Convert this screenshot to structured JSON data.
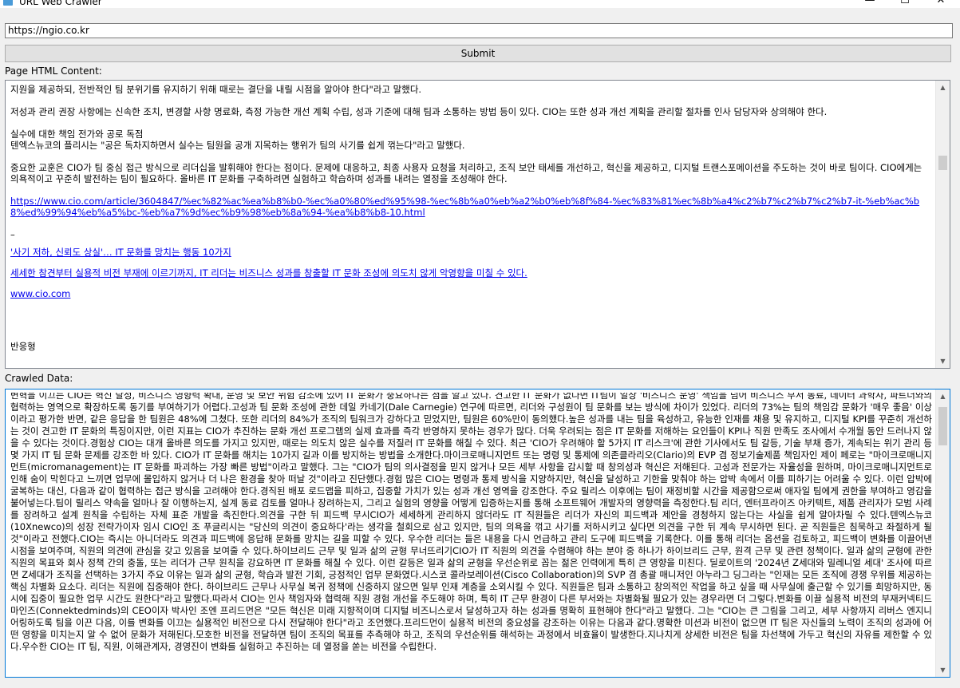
{
  "window": {
    "title": "URL Web Crawler",
    "minimize": "—",
    "maximize": "☐",
    "close": "✕"
  },
  "url_input": {
    "value": "https://ngio.co.kr"
  },
  "submit": {
    "label": "Submit"
  },
  "html_panel": {
    "label": "Page HTML Content:",
    "lines": [
      "지원을 제공하되, 전반적인 팀 분위기를 유지하기 위해 때로는 결단을 내릴 시점을 알아야 한다\"라고 말했다.",
      "",
      "저성과 관리 권장 사항에는 신속한 조치, 변경할 사항 명료화, 측정 가능한 개선 계획 수립, 성과 기준에 대해 팀과 소통하는 방법 등이 있다. CIO는 또한 성과 개선 계획을 관리할 절차를 인사 담당자와 상의해야 한다.",
      "",
      "실수에 대한 책임 전가와 공로 독점",
      "텐엑스뉴코의 플리시는 \"공은 독차지하면서 실수는 팀원을 공개 지목하는 행위가 팀의 사기를 쉽게 꺾는다\"라고 말했다.",
      "",
      "중요한 교훈은 CIO가 팀 중심 접근 방식으로 리더십을 발휘해야 한다는 점이다. 문제에 대응하고, 최종 사용자 요청을 처리하고, 조직 보안 태세를 개선하고, 혁신을 제공하고, 디지털 트랜스포메이션을 주도하는 것이 바로 팀이다. CIO에게는 의욕적이고 꾸준히 발전하는 팀이 필요하다. 올바른 IT 문화를 구축하려면 실험하고 학습하며 성과를 내려는 열정을 조성해야 한다."
    ],
    "link1": "https://www.cio.com/article/3604847/%ec%82%ac%ea%b8%b0-%ec%a0%80%ed%95%98-%ec%8b%a0%eb%a2%b0%eb%8f%84-%ec%83%81%ec%8b%a4%c2%b7%c2%b7%c2%b7-it-%eb%ac%b8%ed%99%94%eb%a5%bc-%eb%a7%9d%ec%b9%98%eb%8a%94-%ea%b8%b8-10.html",
    "dash": "–",
    "link2": "'사기 저하, 신뢰도 상실'… IT 문화를 망치는 행동 10가지",
    "link3": "세세한 참견부터 실용적 비전 부재에 이르기까지, IT 리더는 비즈니스 성과를 창출할 IT 문화 조성에 의도치 않게 악영향을 미칠 수 있다.",
    "link4": "www.cio.com",
    "tail": "반응형"
  },
  "crawl_panel": {
    "label": "Crawled Data:",
    "text": "변혁을 이끄는 CIO는 혁신 달성, 비즈니스 영향력 확대, 운영 및 보안 위험 감소에 있어 IT 문화가 중요하다는 점을 알고 있다. 견고한 IT 문화가 없다면 IT팀이 일상 '비즈니스 운영' 책임을 넘어 비즈니스 부서 동료, 데이터 과학자, 파트너와의 협력하는 영역으로 확장하도록 동기를 부여하기가 어렵다.고성과 팀 문화 조성에 관한 데일 카네기(Dale Carnegie) 연구에 따르면, 리더와 구성원이 팀 문화를 보는 방식에 차이가 있었다. 리더의 73%는 팀의 책임감 문화가 '매우 좋음' 이상이라고 평가한 반면, 같은 응답을 한 팀원은 48%에 그쳤다. 또한 리더의 84%가 조직의 팀워크가 강하다고 믿었지만, 팀원은 60%만이 동의했다.높은 성과를 내는 팀을 육성하고, 유능한 인재를 채용 및 유지하고, 디지털 KPI를 꾸준히 개선하는 것이 견고한 IT 문화의 특징이지만, 이런 지표는 CIO가 추진하는 문화 개선 프로그램의 실제 효과를 즉각 반영하지 못하는 경우가 많다. 더욱 우려되는 점은 IT 문화를 저해하는 요인들이 KPI나 직원 만족도 조사에서 수개월 동안 드러나지 않을 수 있다는 것이다.경험상 CIO는 대개 올바른 의도를 가지고 있지만, 때로는 의도치 않은 실수를 저질러 IT 문화를 해칠 수 있다. 최근 'CIO가 우려해야 할 5가지 IT 리스크'에 관한 기사에서도 팀 갈등, 기술 부채 증가, 계속되는 위기 관리 등 몇 가지 IT 팀 문화 문제를 강조한 바 있다. CIO가 IT 문화를 해치는 10가지 길과 이를 방지하는 방법을 소개한다.마이크로매니지먼트 또는 명령 및 통제에 의존클라리오(Clario)의 EVP 겸 정보기술제품 책임자인 제이 페로는 \"마이크로매니지먼트(micromanagement)는 IT 문화를 파괴하는 가장 빠른 방법\"이라고 말했다. 그는 \"CIO가 팀의 의사결정을 믿지 않거나 모든 세부 사항을 감시할 때 창의성과 혁신은 저해된다. 고성과 전문가는 자율성을 원하며, 마이크로매니지먼트로 인해 숨이 막힌다고 느끼면 업무에 몰입하지 않거나 더 나은 환경을 찾아 떠날 것\"이라고 진단했다.경험 많은 CIO는 명령과 통제 방식을 지양하지만, 혁신을 달성하고 기한을 맞춰야 하는 압박 속에서 이를 피하기는 어려울 수 있다. 이런 압박에 굴복하는 대신, 다음과 같이 협력하는 접근 방식을 고려해야 한다.경직된 배포 로드맵을 피하고, 집중할 가치가 있는 성과 개선 영역을 강조한다. 주요 릴리스 이후에는 팀이 재정비할 시간을 제공함으로써 애자일 팀에게 권한을 부여하고 영감을 불어넣는다.팀이 릴리스 약속을 얼마나 잘 이행하는지, 설계 동료 검토를 얼마나 장려하는지, 그리고 실험의 영향을 어떻게 입증하는지를 통해 소프트웨어 개발자의 영향력을 측정한다.팀 리더, 엔터프라이즈 아키텍트, 제품 관리자가 모범 사례를 장려하고 설계 원칙을 수립하는 자체 표준 개발을 촉진한다.의견을 구한 뒤 피드백 무시CIO가 세세하게 관리하지 않더라도 IT 직원들은 리더가 자신의 피드백과 제안을 경청하지 않는다는 사실을 쉽게 알아차릴 수 있다.텐엑스뉴코(10Xnewco)의 성장 전략가이자 임시 CIO인 조 푸글리시는 \"당신의 의견이 중요하다'라는 생각을 철회으로 삼고 있지만, 팀의 의욕을 꺾고 사기를 저하시키고 싶다면 의견을 구한 뒤 계속 무시하면 된다. 곧 직원들은 침묵하고 좌절하게 될 것\"이라고 전했다.CIO는 즉시는 아니더라도 의견과 피드백에 응답해 문화를 망치는 길을 피할 수 있다. 우수한 리더는 들은 내용을 다시 언급하고 관리 도구에 피드백을 기록한다. 이를 통해 리더는 옵션을 검토하고, 피드백이 변화를 이끌어낸 시점을 보여주며, 직원의 의견에 관심을 갖고 있음을 보여줄 수 있다.하이브리드 근무 및 일과 삶의 균형 무너뜨리기CIO가 IT 직원의 의견을 수렴해야 하는 분야 중 하나가 하이브리드 근무, 원격 근무 및 관련 정책이다. 일과 삶의 균형에 관한 직원의 목표와 회사 정책 간의 충돌, 또는 리더가 근무 원칙을 강요하면 IT 문화를 해칠 수 있다. 이런 갈등은 일과 삶의 균형을 우선순위로 꼽는 젊은 인력에게 특히 큰 영향을 미친다. 딜로이트의 '2024년 Z세대와 밀레니얼 세대' 조사에 따르면 Z세대가 조직을 선택하는 3가지 주요 이유는 일과 삶의 균형, 학습과 발전 기회, 긍정적인 업무 문화였다.시스코 콜라보레이션(Cisco Collaboration)의 SVP 겸 총괄 매니저인 아누라그 딩그라는 \"인재는 모든 조직에 경쟁 우위를 제공하는 핵심 차별화 요소다. 리더는 직원에 집중해야 한다. 하이브리드 근무나 사무실 복귀 정책에 신중하지 않으면 일부 인재 계층을 소외시킬 수 있다. 직원들은 팀과 소통하고 창의적인 작업을 하고 싶을 때 사무실에 출근할 수 있기를 희망하지만, 동시에 집중이 필요한 업무 시간도 원한다\"라고 말했다.따라서 CIO는 인사 책임자와 협력해 직원 경험 개선을 주도해야 하며, 특히 IT 근무 환경이 다른 부서와는 차별화될 필요가 있는 경우라면 더 그렇다.변화를 이끌 실용적 비전의 부재커넥티드마인즈(Connektedminds)의 CEO이자 박사인 조엔 프리드먼은 \"모든 혁신은 미래 지향적이며 디지털 비즈니스로서 달성하고자 하는 성과를 명확히 표현해야 한다\"라고 말했다. 그는 \"CIO는 큰 그림을 그리고, 세부 사항까지 리버스 엔지니어링하도록 팀을 이끈 다음, 이를 변화를 이끄는 실용적인 비전으로 다시 전달해야 한다\"라고 조언했다.프리드먼이 실용적 비전의 중요성을 강조하는 이유는 다음과 같다.명확한 미션과 비전이 없으면 IT 팀은 자신들의 노력이 조직의 성과에 어떤 영향을 미치는지 알 수 없어 문화가 저해된다.모호한 비전을 전달하면 팀이 조직의 목표를 추측해야 하고, 조직의 우선순위를 해석하는 과정에서 비효율이 발생한다.지나치게 상세한 비전은 팀을 차선책에 가두고 혁신의 자유를 제한할 수 있다.우수한 CIO는 IT 팀, 직원, 이해관계자, 경영진이 변화를 실험하고 추진하는 데 열정을 쏟는 비전을 수립한다."
  }
}
